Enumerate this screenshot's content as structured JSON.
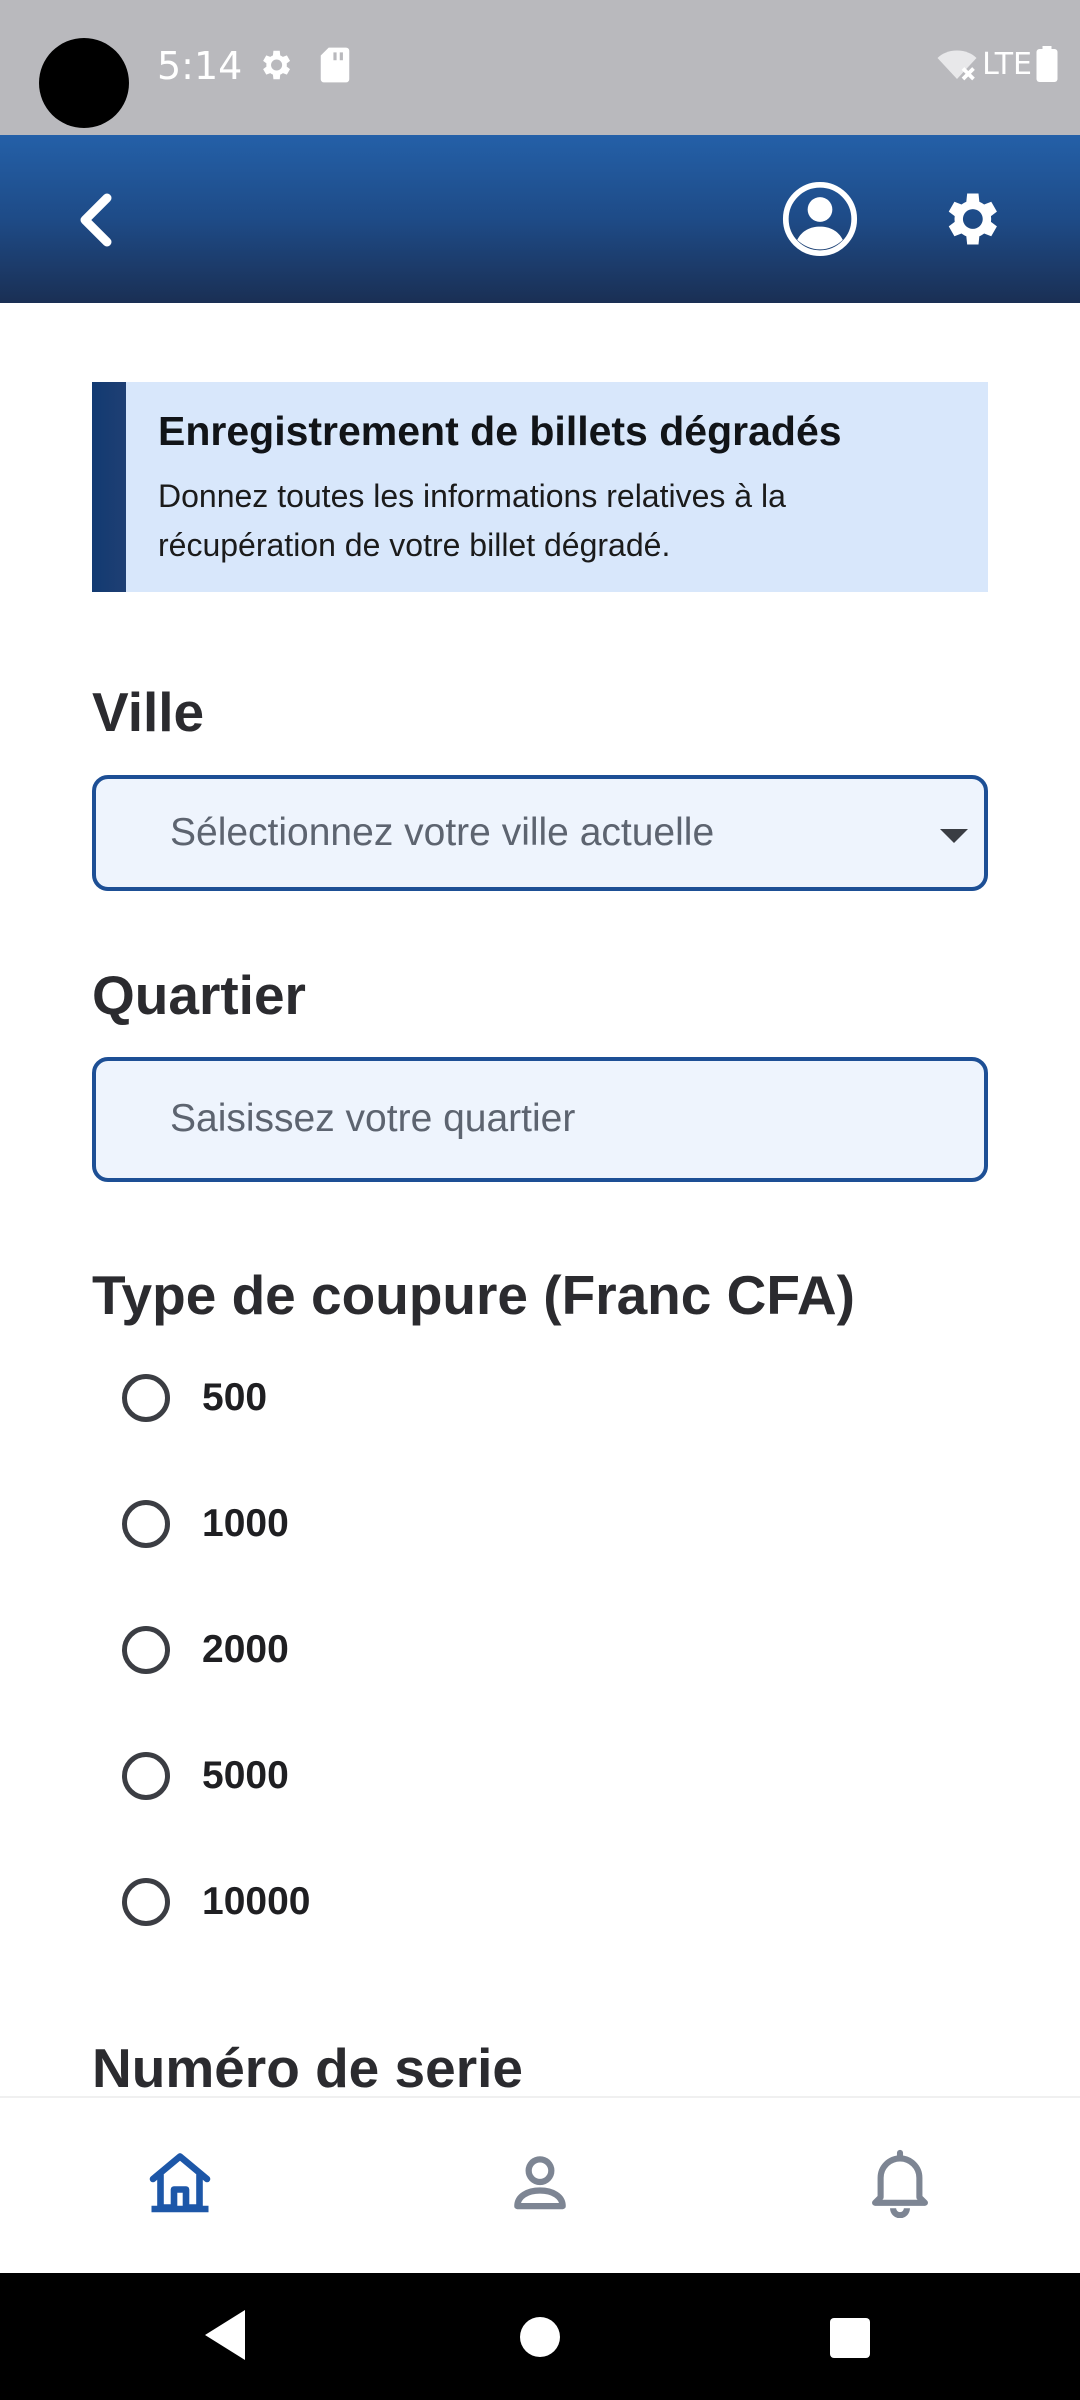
{
  "status_bar": {
    "time": "5:14",
    "network": "LTE",
    "icons": [
      "settings-icon",
      "sd-card-icon",
      "wifi-off-icon",
      "battery-icon"
    ]
  },
  "app_bar": {
    "icons": [
      "back-icon",
      "account-icon",
      "settings-icon"
    ],
    "background_colors": [
      "#2460a8",
      "#1a2f54"
    ]
  },
  "banner": {
    "title": "Enregistrement de billets dégradés",
    "text": "Donnez toutes les informations relatives à la récupération de votre billet dégradé."
  },
  "form": {
    "ville": {
      "label": "Ville",
      "placeholder": "Sélectionnez votre ville actuelle"
    },
    "quartier": {
      "label": "Quartier",
      "placeholder": "Saisissez votre quartier"
    },
    "coupure": {
      "label": "Type de coupure (Franc CFA)",
      "options": [
        "500",
        "1000",
        "2000",
        "5000",
        "10000"
      ]
    },
    "serie": {
      "label": "Numéro de serie"
    }
  },
  "bottom_nav": {
    "items": [
      "home-icon",
      "profile-icon",
      "notifications-icon"
    ],
    "active_color": "#1d57a8",
    "inactive_color": "#7d8593"
  }
}
